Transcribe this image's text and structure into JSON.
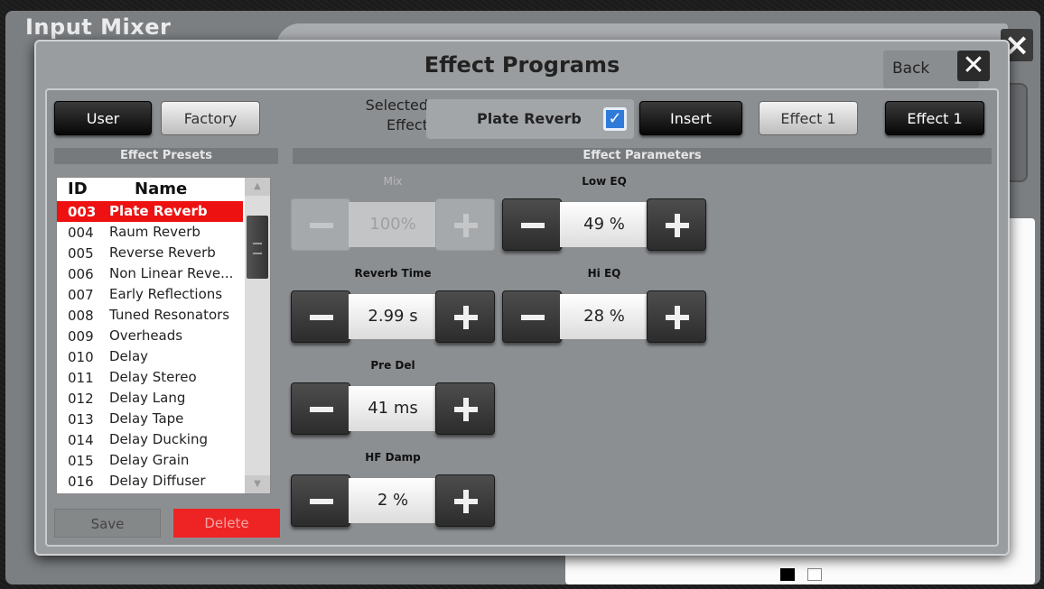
{
  "background_window": {
    "title": "Input Mixer"
  },
  "dialog": {
    "title": "Effect Programs",
    "back_label": "Back",
    "close_glyph": "✕"
  },
  "bank_buttons": {
    "user": "User",
    "factory": "Factory"
  },
  "selected_effect": {
    "label_line1": "Selected",
    "label_line2": "Effect",
    "value": "Plate Reverb",
    "checked_glyph": "✓"
  },
  "actions": {
    "insert": "Insert",
    "effect1_light": "Effect 1",
    "effect1_dark": "Effect 1"
  },
  "presets": {
    "header": "Effect Presets",
    "col_id": "ID",
    "col_name": "Name",
    "items": [
      {
        "id": "003",
        "name": "Plate Reverb",
        "selected": true
      },
      {
        "id": "004",
        "name": "Raum Reverb"
      },
      {
        "id": "005",
        "name": "Reverse Reverb"
      },
      {
        "id": "006",
        "name": "Non Linear Reve..."
      },
      {
        "id": "007",
        "name": "Early Reflections"
      },
      {
        "id": "008",
        "name": "Tuned Resonators"
      },
      {
        "id": "009",
        "name": "Overheads"
      },
      {
        "id": "010",
        "name": "Delay"
      },
      {
        "id": "011",
        "name": "Delay Stereo"
      },
      {
        "id": "012",
        "name": "Delay Lang"
      },
      {
        "id": "013",
        "name": "Delay Tape"
      },
      {
        "id": "014",
        "name": "Delay Ducking"
      },
      {
        "id": "015",
        "name": "Delay Grain"
      },
      {
        "id": "016",
        "name": "Delay Diffuser"
      }
    ],
    "save_label": "Save",
    "delete_label": "Delete"
  },
  "parameters": {
    "header": "Effect Parameters",
    "mix": {
      "label": "Mix",
      "value": "100%",
      "disabled": true
    },
    "low_eq": {
      "label": "Low EQ",
      "value": "49 %"
    },
    "reverb_time": {
      "label": "Reverb Time",
      "value": "2.99 s"
    },
    "hi_eq": {
      "label": "Hi EQ",
      "value": "28 %"
    },
    "pre_del": {
      "label": "Pre Del",
      "value": "41 ms"
    },
    "hf_damp": {
      "label": "HF Damp",
      "value": "2 %"
    }
  },
  "colors": {
    "selected_row": "#ee1111",
    "checkbox": "#2f7ad8",
    "delete": "#ee2424"
  }
}
